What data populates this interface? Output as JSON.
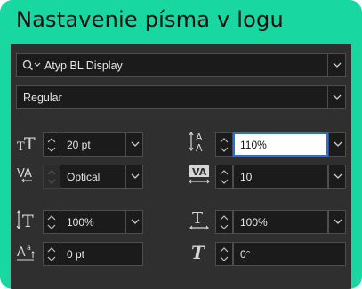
{
  "header": {
    "title": "Nastavenie písma v logu"
  },
  "font": {
    "family": "Atyp BL Display",
    "style": "Regular"
  },
  "controls": {
    "font_size": "20 pt",
    "leading": "110%",
    "kerning": "Optical",
    "tracking": "10",
    "vertical_scale": "100%",
    "horizontal_scale": "100%",
    "baseline_shift": "0 pt",
    "skew": "0°"
  },
  "colors": {
    "accent": "#18d7a1",
    "panel": "#2f2f2f",
    "field": "#1b1b1b",
    "focus": "#2d6fd2"
  }
}
